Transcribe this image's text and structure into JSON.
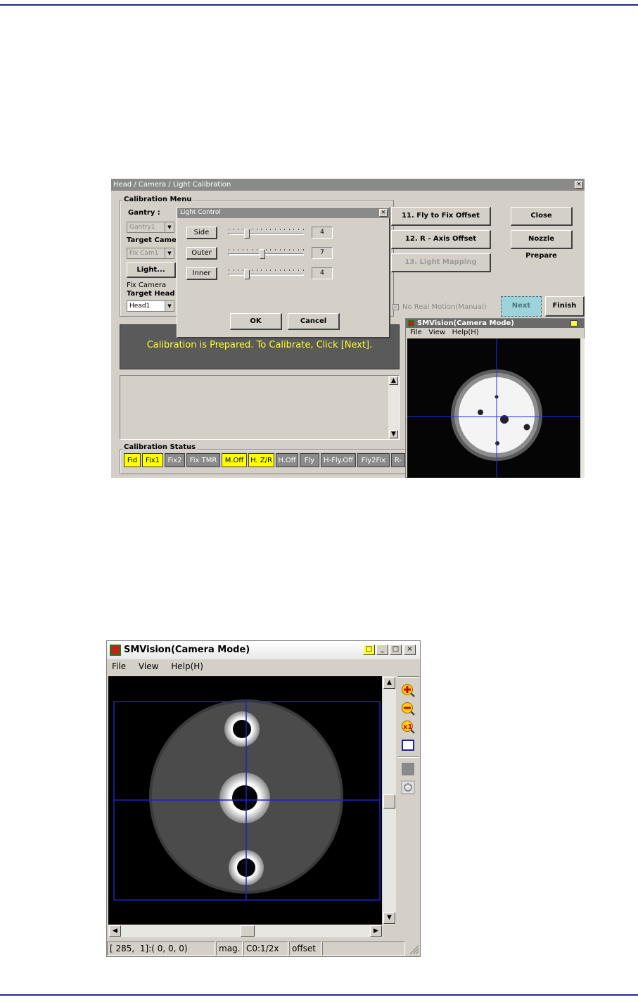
{
  "calibration_window": {
    "title": "Head / Camera / Light Calibration",
    "menu_group": "Calibration Menu",
    "gantry_label": "Gantry :",
    "gantry_value": "Gantry1",
    "target_camera_label": "Target Camera",
    "target_camera_value": "Fix Cam1",
    "light_button": "Light...",
    "fix_camera_label": "Fix Camera",
    "target_head_label": "Target Head",
    "target_head_value": "Head1",
    "step_buttons": [
      "11. Fly to Fix Offset",
      "12. R - Axis Offset",
      "13. Light Mapping"
    ],
    "close_button": "Close",
    "nozzle_button": "Nozzle Prepare",
    "no_real_motion": "No Real Motion(Manual)",
    "next_button": "Next",
    "finish_button": "Finish",
    "message": "Calibration is Prepared. To Calibrate, Click [Next].",
    "status_group": "Calibration Status",
    "status_items": [
      {
        "label": "Fid",
        "color": "#ffff00"
      },
      {
        "label": "Fix1",
        "color": "#ffff00"
      },
      {
        "label": "Fix2",
        "color": "#8a8a8a"
      },
      {
        "label": "Fix TMR",
        "color": "#8a8a8a"
      },
      {
        "label": "M.Off",
        "color": "#ffff00"
      },
      {
        "label": "H. Z/R",
        "color": "#ffff00"
      },
      {
        "label": "H.Off",
        "color": "#8a8a8a"
      },
      {
        "label": "Fly",
        "color": "#8a8a8a"
      },
      {
        "label": "H-Fly.Off",
        "color": "#8a8a8a"
      },
      {
        "label": "Fly2Fix",
        "color": "#8a8a8a"
      },
      {
        "label": "R-",
        "color": "#8a8a8a"
      }
    ]
  },
  "light_control": {
    "title": "Light Control",
    "rows": [
      {
        "label": "Side",
        "value": "4",
        "level": 0.25
      },
      {
        "label": "Outer",
        "value": "7",
        "level": 0.45
      },
      {
        "label": "Inner",
        "value": "4",
        "level": 0.25
      }
    ],
    "ok": "OK",
    "cancel": "Cancel"
  },
  "smvision_small": {
    "title": "SMVision(Camera Mode)",
    "menu": [
      "File",
      "View",
      "Help(H)"
    ]
  },
  "smvision_large": {
    "title": "SMVision(Camera Mode)",
    "menu": [
      "File",
      "View",
      "Help(H)"
    ],
    "status": {
      "coords": "[ 285,  1]:( 0, 0, 0)",
      "mag_label": "mag.",
      "mag_value": "C0:1/2x",
      "offset_label": "offset"
    },
    "tools": [
      "zoom-in-icon",
      "zoom-out-icon",
      "zoom-1x-icon",
      "fit-window-icon",
      "grey-square-icon",
      "rotate-icon"
    ]
  }
}
